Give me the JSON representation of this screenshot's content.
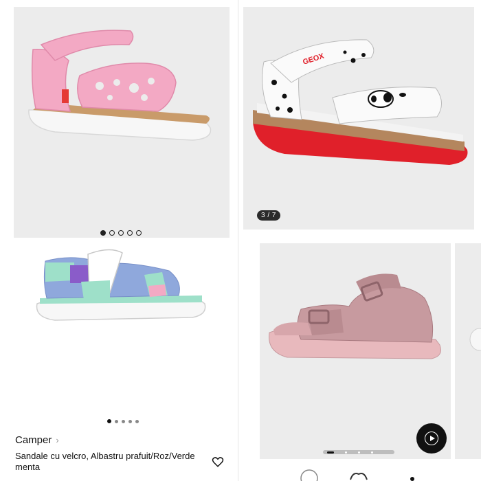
{
  "products": [
    {
      "image_name": "pink-cutout-sandal",
      "dots": {
        "count": 5,
        "active": 0
      }
    },
    {
      "image_name": "geox-white-spotted-sandal",
      "counter": "3 / 7",
      "brand_print": "GEOX"
    },
    {
      "image_name": "blue-mint-velcro-sandal",
      "dots": {
        "count": 5,
        "active": 0
      },
      "brand": "Camper",
      "title": "Sandale cu velcro, Albastru prafuit/Roz/Verde menta"
    },
    {
      "image_name": "mauve-leather-sandal",
      "has_video": true
    }
  ],
  "colors": {
    "image_bg": "#ececec",
    "text": "#111111",
    "pink": "#f3a9c4",
    "red_sole": "#e0202a",
    "cork": "#b4865e",
    "mauve": "#c79a9f"
  }
}
